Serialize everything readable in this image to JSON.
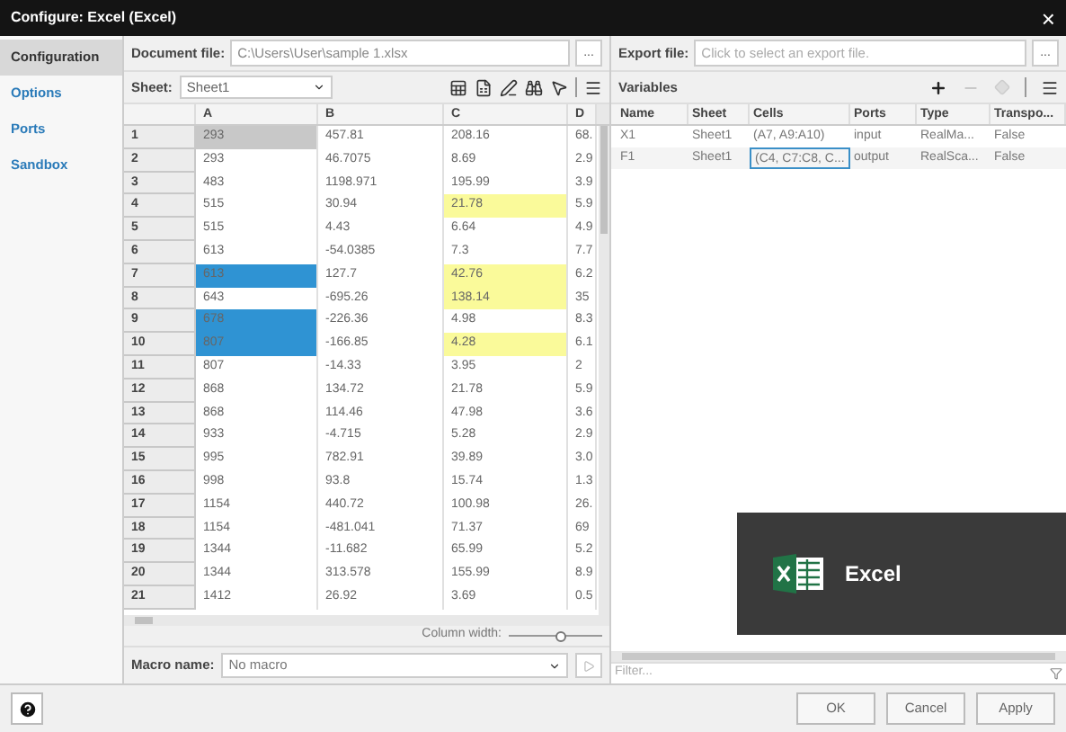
{
  "window": {
    "title": "Configure: Excel (Excel)",
    "close": "×"
  },
  "sidebar": {
    "items": [
      {
        "label": "Configuration",
        "selected": true
      },
      {
        "label": "Options",
        "selected": false
      },
      {
        "label": "Ports",
        "selected": false
      },
      {
        "label": "Sandbox",
        "selected": false
      }
    ]
  },
  "document_file": {
    "label": "Document file:",
    "value": "C:\\Users\\User\\sample 1.xlsx",
    "browse": "..."
  },
  "sheet": {
    "label": "Sheet:",
    "value": "Sheet1"
  },
  "grid": {
    "columns": [
      "A",
      "B",
      "C",
      "D"
    ],
    "rows": [
      {
        "number": "1",
        "cells": [
          {
            "text": "293",
            "color": "#c8c8c8"
          },
          {
            "text": "457.81",
            "color": "#ffffff"
          },
          {
            "text": "208.16",
            "color": "#ffffff"
          },
          {
            "text": "68.",
            "color": "#ffffff"
          }
        ]
      },
      {
        "number": "2",
        "cells": [
          {
            "text": "293",
            "color": "#ffffff"
          },
          {
            "text": "46.7075",
            "color": "#ffffff"
          },
          {
            "text": "8.69",
            "color": "#ffffff"
          },
          {
            "text": "2.9",
            "color": "#ffffff"
          }
        ]
      },
      {
        "number": "3",
        "cells": [
          {
            "text": "483",
            "color": "#ffffff"
          },
          {
            "text": "1198.971",
            "color": "#ffffff"
          },
          {
            "text": "195.99",
            "color": "#ffffff"
          },
          {
            "text": "3.9",
            "color": "#ffffff"
          }
        ]
      },
      {
        "number": "4",
        "cells": [
          {
            "text": "515",
            "color": "#ffffff"
          },
          {
            "text": "30.94",
            "color": "#ffffff"
          },
          {
            "text": "21.78",
            "color": "#fafa9a"
          },
          {
            "text": "5.9",
            "color": "#ffffff"
          }
        ]
      },
      {
        "number": "5",
        "cells": [
          {
            "text": "515",
            "color": "#ffffff"
          },
          {
            "text": "4.43",
            "color": "#ffffff"
          },
          {
            "text": "6.64",
            "color": "#ffffff"
          },
          {
            "text": "4.9",
            "color": "#ffffff"
          }
        ]
      },
      {
        "number": "6",
        "cells": [
          {
            "text": "613",
            "color": "#ffffff"
          },
          {
            "text": "-54.0385",
            "color": "#ffffff"
          },
          {
            "text": "7.3",
            "color": "#ffffff"
          },
          {
            "text": "7.7",
            "color": "#ffffff"
          }
        ]
      },
      {
        "number": "7",
        "cells": [
          {
            "text": "613",
            "color": "#2f93d3"
          },
          {
            "text": "127.7",
            "color": "#ffffff"
          },
          {
            "text": "42.76",
            "color": "#fafa9a"
          },
          {
            "text": "6.2",
            "color": "#ffffff"
          }
        ]
      },
      {
        "number": "8",
        "cells": [
          {
            "text": "643",
            "color": "#ffffff"
          },
          {
            "text": "-695.26",
            "color": "#ffffff"
          },
          {
            "text": "138.14",
            "color": "#fafa9a"
          },
          {
            "text": "35",
            "color": "#ffffff"
          }
        ]
      },
      {
        "number": "9",
        "cells": [
          {
            "text": "678",
            "color": "#2f93d3"
          },
          {
            "text": "-226.36",
            "color": "#ffffff"
          },
          {
            "text": "4.98",
            "color": "#ffffff"
          },
          {
            "text": "8.3",
            "color": "#ffffff"
          }
        ]
      },
      {
        "number": "10",
        "cells": [
          {
            "text": "807",
            "color": "#2f93d3"
          },
          {
            "text": "-166.85",
            "color": "#ffffff"
          },
          {
            "text": "4.28",
            "color": "#fafa9a"
          },
          {
            "text": "6.1",
            "color": "#ffffff"
          }
        ]
      },
      {
        "number": "11",
        "cells": [
          {
            "text": "807",
            "color": "#ffffff"
          },
          {
            "text": "-14.33",
            "color": "#ffffff"
          },
          {
            "text": "3.95",
            "color": "#ffffff"
          },
          {
            "text": "2",
            "color": "#ffffff"
          }
        ]
      },
      {
        "number": "12",
        "cells": [
          {
            "text": "868",
            "color": "#ffffff"
          },
          {
            "text": "134.72",
            "color": "#ffffff"
          },
          {
            "text": "21.78",
            "color": "#ffffff"
          },
          {
            "text": "5.9",
            "color": "#ffffff"
          }
        ]
      },
      {
        "number": "13",
        "cells": [
          {
            "text": "868",
            "color": "#ffffff"
          },
          {
            "text": "114.46",
            "color": "#ffffff"
          },
          {
            "text": "47.98",
            "color": "#ffffff"
          },
          {
            "text": "3.6",
            "color": "#ffffff"
          }
        ]
      },
      {
        "number": "14",
        "cells": [
          {
            "text": "933",
            "color": "#ffffff"
          },
          {
            "text": "-4.715",
            "color": "#ffffff"
          },
          {
            "text": "5.28",
            "color": "#ffffff"
          },
          {
            "text": "2.9",
            "color": "#ffffff"
          }
        ]
      },
      {
        "number": "15",
        "cells": [
          {
            "text": "995",
            "color": "#ffffff"
          },
          {
            "text": "782.91",
            "color": "#ffffff"
          },
          {
            "text": "39.89",
            "color": "#ffffff"
          },
          {
            "text": "3.0",
            "color": "#ffffff"
          }
        ]
      },
      {
        "number": "16",
        "cells": [
          {
            "text": "998",
            "color": "#ffffff"
          },
          {
            "text": "93.8",
            "color": "#ffffff"
          },
          {
            "text": "15.74",
            "color": "#ffffff"
          },
          {
            "text": "1.3",
            "color": "#ffffff"
          }
        ]
      },
      {
        "number": "17",
        "cells": [
          {
            "text": "1154",
            "color": "#ffffff"
          },
          {
            "text": "440.72",
            "color": "#ffffff"
          },
          {
            "text": "100.98",
            "color": "#ffffff"
          },
          {
            "text": "26.",
            "color": "#ffffff"
          }
        ]
      },
      {
        "number": "18",
        "cells": [
          {
            "text": "1154",
            "color": "#ffffff"
          },
          {
            "text": "-481.041",
            "color": "#ffffff"
          },
          {
            "text": "71.37",
            "color": "#ffffff"
          },
          {
            "text": "69",
            "color": "#ffffff"
          }
        ]
      },
      {
        "number": "19",
        "cells": [
          {
            "text": "1344",
            "color": "#ffffff"
          },
          {
            "text": "-11.682",
            "color": "#ffffff"
          },
          {
            "text": "65.99",
            "color": "#ffffff"
          },
          {
            "text": "5.2",
            "color": "#ffffff"
          }
        ]
      },
      {
        "number": "20",
        "cells": [
          {
            "text": "1344",
            "color": "#ffffff"
          },
          {
            "text": "313.578",
            "color": "#ffffff"
          },
          {
            "text": "155.99",
            "color": "#ffffff"
          },
          {
            "text": "8.9",
            "color": "#ffffff"
          }
        ]
      },
      {
        "number": "21",
        "cells": [
          {
            "text": "1412",
            "color": "#ffffff"
          },
          {
            "text": "26.92",
            "color": "#ffffff"
          },
          {
            "text": "3.69",
            "color": "#ffffff"
          },
          {
            "text": "0.5",
            "color": "#ffffff"
          }
        ]
      }
    ]
  },
  "column_width": {
    "label": "Column width:",
    "level": 0.55
  },
  "macro": {
    "label": "Macro name:",
    "value": "No macro"
  },
  "export_file": {
    "label": "Export file:",
    "placeholder": "Click to select an export file.",
    "browse": "..."
  },
  "variables": {
    "title": "Variables",
    "columns": [
      "Name",
      "Sheet",
      "Cells",
      "Ports",
      "Type",
      "Transpo..."
    ],
    "rows": [
      {
        "name": "X1",
        "sheet": "Sheet1",
        "cells": "(A7, A9:A10)",
        "ports": "input",
        "type": "RealMa...",
        "transpose": "False",
        "selected": false
      },
      {
        "name": "F1",
        "sheet": "Sheet1",
        "cells": "(C4, C7:C8, C...",
        "ports": "output",
        "type": "RealSca...",
        "transpose": "False",
        "selected": true
      }
    ]
  },
  "filter": {
    "placeholder": "Filter..."
  },
  "toast": {
    "text": "Excel"
  },
  "buttons": [
    "OK",
    "Cancel",
    "Apply"
  ]
}
